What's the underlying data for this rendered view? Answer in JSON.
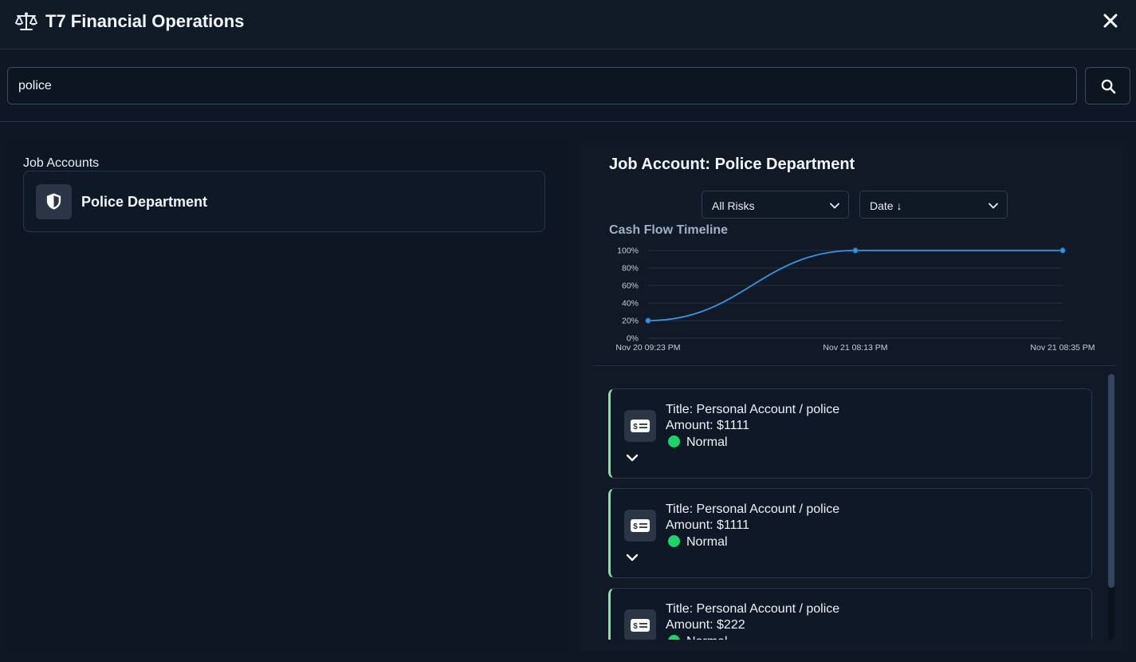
{
  "header": {
    "title": "T7 Financial Operations",
    "logo_icon": "balance-scale-icon",
    "close_icon": "close-icon"
  },
  "search": {
    "value": "police",
    "button_icon": "search-icon"
  },
  "left": {
    "section_label": "Job Accounts",
    "accounts": [
      {
        "name": "Police Department",
        "icon": "shield-icon"
      }
    ]
  },
  "right": {
    "title": "Job Account: Police Department",
    "filters": {
      "risk": "All Risks",
      "sort": "Date ↓"
    },
    "chart_title": "Cash Flow Timeline",
    "transactions": [
      {
        "title": "Title: Personal Account / police",
        "amount": "Amount: $1111",
        "status": "Normal",
        "icon": "money-bill-icon"
      },
      {
        "title": "Title: Personal Account / police",
        "amount": "Amount: $1111",
        "status": "Normal",
        "icon": "money-bill-icon"
      },
      {
        "title": "Title: Personal Account / police",
        "amount": "Amount: $222",
        "status": "Normal",
        "icon": "money-bill-icon"
      }
    ]
  },
  "colors": {
    "accent_line": "#3b93e0",
    "status_normal": "#1fd26a",
    "card_border_left": "#86e2a4"
  },
  "chart_data": {
    "type": "line",
    "x": [
      "Nov 20 09:23 PM",
      "Nov 21 08:13 PM",
      "Nov 21 08:35 PM"
    ],
    "series": [
      {
        "values": [
          20,
          100,
          100
        ]
      }
    ],
    "yticks": [
      "0%",
      "20%",
      "40%",
      "60%",
      "80%",
      "100%"
    ],
    "ylim": [
      0,
      100
    ],
    "grid": true,
    "legend": "none"
  }
}
